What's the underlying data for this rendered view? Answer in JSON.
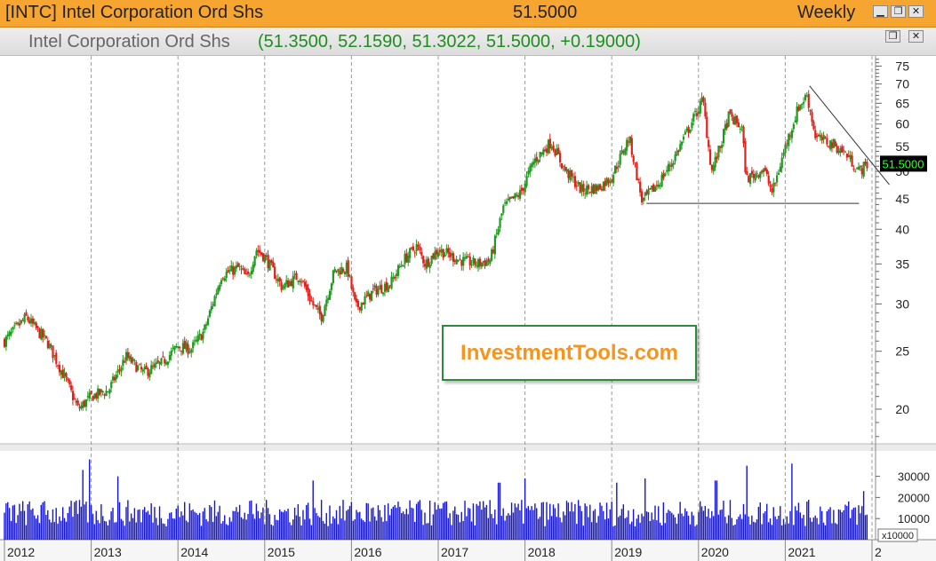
{
  "window": {
    "symbol_title": "[INTC] Intel Corporation Ord Shs",
    "last_price": "51.5000",
    "period": "Weekly",
    "controls": {
      "minimize": "▁",
      "restore": "❐",
      "close": "✕"
    }
  },
  "subheader": {
    "name": "Intel Corporation Ord Shs",
    "ohlc": "(51.3500, 52.1590, 51.3022, 51.5000, +0.19000)"
  },
  "watermark": "InvestmentTools.com",
  "colors": {
    "up": "#1e9a1e",
    "down": "#e0201a",
    "volume": "#1414d6",
    "price_tag_bg": "#000000",
    "price_tag_text": "#33ff33",
    "accent": "#f7a531"
  },
  "chart_data": {
    "type": "candlestick",
    "scale": "log",
    "grid": "vertical-dashed",
    "x_tick_labels": [
      "2012",
      "2013",
      "2014",
      "2015",
      "2016",
      "2017",
      "2018",
      "2019",
      "2020",
      "2021",
      "2"
    ],
    "y_ticks": [
      20,
      25,
      30,
      35,
      40,
      45,
      50,
      55,
      60,
      65,
      70,
      75
    ],
    "ylim": [
      17.5,
      78
    ],
    "last_price_label": "51.5000",
    "anchors": [
      {
        "t": 2012.0,
        "p": 26.0
      },
      {
        "t": 2012.25,
        "p": 28.5
      },
      {
        "t": 2012.5,
        "p": 25.8
      },
      {
        "t": 2012.7,
        "p": 22.5
      },
      {
        "t": 2012.85,
        "p": 20.0
      },
      {
        "t": 2013.0,
        "p": 21.0
      },
      {
        "t": 2013.2,
        "p": 21.5
      },
      {
        "t": 2013.4,
        "p": 24.5
      },
      {
        "t": 2013.6,
        "p": 23.0
      },
      {
        "t": 2013.8,
        "p": 23.8
      },
      {
        "t": 2014.0,
        "p": 25.5
      },
      {
        "t": 2014.15,
        "p": 25.2
      },
      {
        "t": 2014.3,
        "p": 27.0
      },
      {
        "t": 2014.5,
        "p": 33.5
      },
      {
        "t": 2014.7,
        "p": 34.5
      },
      {
        "t": 2014.8,
        "p": 33.0
      },
      {
        "t": 2014.9,
        "p": 37.0
      },
      {
        "t": 2015.0,
        "p": 36.0
      },
      {
        "t": 2015.2,
        "p": 32.0
      },
      {
        "t": 2015.4,
        "p": 33.5
      },
      {
        "t": 2015.55,
        "p": 30.0
      },
      {
        "t": 2015.65,
        "p": 28.5
      },
      {
        "t": 2015.8,
        "p": 34.0
      },
      {
        "t": 2015.95,
        "p": 34.5
      },
      {
        "t": 2016.05,
        "p": 29.5
      },
      {
        "t": 2016.25,
        "p": 31.5
      },
      {
        "t": 2016.45,
        "p": 32.5
      },
      {
        "t": 2016.6,
        "p": 35.5
      },
      {
        "t": 2016.75,
        "p": 37.5
      },
      {
        "t": 2016.85,
        "p": 35.0
      },
      {
        "t": 2017.0,
        "p": 37.0
      },
      {
        "t": 2017.25,
        "p": 35.5
      },
      {
        "t": 2017.45,
        "p": 35.0
      },
      {
        "t": 2017.6,
        "p": 35.5
      },
      {
        "t": 2017.75,
        "p": 43.5
      },
      {
        "t": 2017.95,
        "p": 46.0
      },
      {
        "t": 2018.1,
        "p": 52.0
      },
      {
        "t": 2018.3,
        "p": 56.0
      },
      {
        "t": 2018.45,
        "p": 50.5
      },
      {
        "t": 2018.65,
        "p": 46.5
      },
      {
        "t": 2018.85,
        "p": 47.0
      },
      {
        "t": 2019.0,
        "p": 49.0
      },
      {
        "t": 2019.2,
        "p": 57.0
      },
      {
        "t": 2019.35,
        "p": 44.5
      },
      {
        "t": 2019.55,
        "p": 48.0
      },
      {
        "t": 2019.7,
        "p": 52.0
      },
      {
        "t": 2019.85,
        "p": 57.5
      },
      {
        "t": 2020.05,
        "p": 66.0
      },
      {
        "t": 2020.15,
        "p": 50.0
      },
      {
        "t": 2020.25,
        "p": 55.0
      },
      {
        "t": 2020.35,
        "p": 62.0
      },
      {
        "t": 2020.5,
        "p": 59.0
      },
      {
        "t": 2020.55,
        "p": 48.5
      },
      {
        "t": 2020.75,
        "p": 50.5
      },
      {
        "t": 2020.85,
        "p": 46.0
      },
      {
        "t": 2021.0,
        "p": 55.0
      },
      {
        "t": 2021.15,
        "p": 64.0
      },
      {
        "t": 2021.25,
        "p": 67.0
      },
      {
        "t": 2021.35,
        "p": 57.0
      },
      {
        "t": 2021.55,
        "p": 55.5
      },
      {
        "t": 2021.7,
        "p": 53.5
      },
      {
        "t": 2021.85,
        "p": 50.0
      },
      {
        "t": 2021.95,
        "p": 51.5
      }
    ],
    "support_line": {
      "t1": 2019.4,
      "t2": 2021.85,
      "p": 44.2
    },
    "resistance_line": {
      "t1": 2021.28,
      "p1": 69.5,
      "t2": 2022.2,
      "p2": 47.5
    },
    "volume": {
      "y_ticks": [
        10000,
        20000,
        30000
      ],
      "unit_label": "x10000",
      "ylim": [
        0,
        42000
      ],
      "typical": 14000,
      "spikes": [
        {
          "t": 2012.98,
          "v": 38000
        },
        {
          "t": 2012.9,
          "v": 33000
        },
        {
          "t": 2013.3,
          "v": 30000
        },
        {
          "t": 2015.55,
          "v": 28000
        },
        {
          "t": 2017.7,
          "v": 27000
        },
        {
          "t": 2018.0,
          "v": 29000
        },
        {
          "t": 2019.05,
          "v": 27000
        },
        {
          "t": 2019.38,
          "v": 29000
        },
        {
          "t": 2020.2,
          "v": 28000
        },
        {
          "t": 2020.55,
          "v": 35000
        },
        {
          "t": 2021.07,
          "v": 36000
        },
        {
          "t": 2021.9,
          "v": 23000
        }
      ]
    }
  }
}
